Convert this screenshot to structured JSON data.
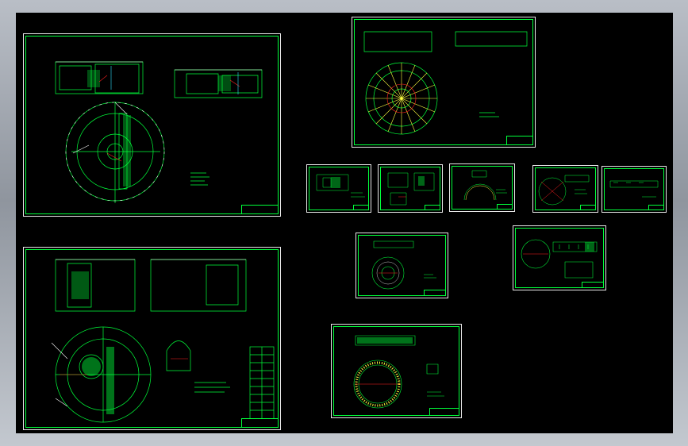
{
  "app": {
    "name": "",
    "background": "#000000"
  },
  "colors": {
    "border": "#ffffff",
    "line": "#00ff3a",
    "accent_red": "#ff2020",
    "accent_yellow": "#ffff40",
    "accent_cyan": "#30e0ff"
  },
  "sheets": [
    {
      "id": "assembly-main",
      "kind": "assembly drawing"
    },
    {
      "id": "assembly-secondary",
      "kind": "assembly drawing"
    },
    {
      "id": "part-disc-radial",
      "kind": "part drawing"
    },
    {
      "id": "part-small-1",
      "kind": "part drawing"
    },
    {
      "id": "part-small-2",
      "kind": "part drawing"
    },
    {
      "id": "part-small-3",
      "kind": "part drawing"
    },
    {
      "id": "part-small-4",
      "kind": "part drawing"
    },
    {
      "id": "part-small-5",
      "kind": "part drawing"
    },
    {
      "id": "part-medium-1",
      "kind": "part drawing"
    },
    {
      "id": "part-medium-2",
      "kind": "part drawing"
    },
    {
      "id": "part-ring",
      "kind": "part drawing"
    }
  ]
}
